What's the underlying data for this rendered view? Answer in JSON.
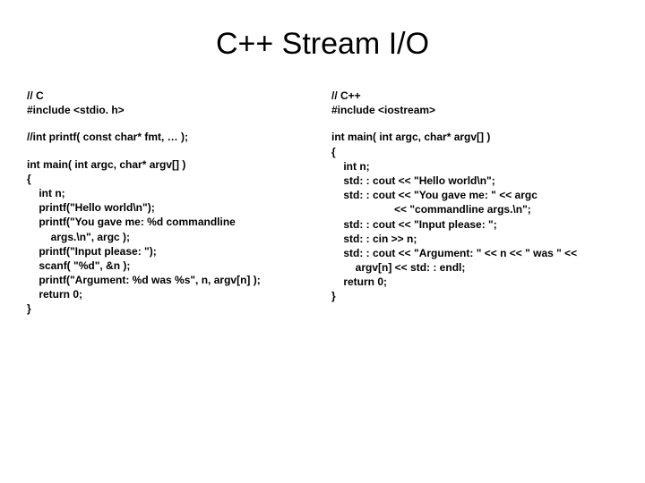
{
  "title": "C++ Stream I/O",
  "left": {
    "header": "// C\n#include <stdio. h>",
    "proto": "//int printf( const char* fmt, … );",
    "code": "int main( int argc, char* argv[] )\n{\n    int n;\n    printf(\"Hello world\\n\");\n    printf(\"You gave me: %d commandline\n        args.\\n\", argc );\n    printf(\"Input please: \");\n    scanf( \"%d\", &n );\n    printf(\"Argument: %d was %s\", n, argv[n] );\n    return 0;\n}"
  },
  "right": {
    "header": "// C++\n#include <iostream>",
    "code": "int main( int argc, char* argv[] )\n{\n    int n;\n    std: : cout << \"Hello world\\n\";\n    std: : cout << \"You gave me: \" << argc\n                     << \"commandline args.\\n\";\n    std: : cout << \"Input please: \";\n    std: : cin >> n;\n    std: : cout << \"Argument: \" << n << \" was \" <<\n        argv[n] << std: : endl;\n    return 0;\n}"
  }
}
